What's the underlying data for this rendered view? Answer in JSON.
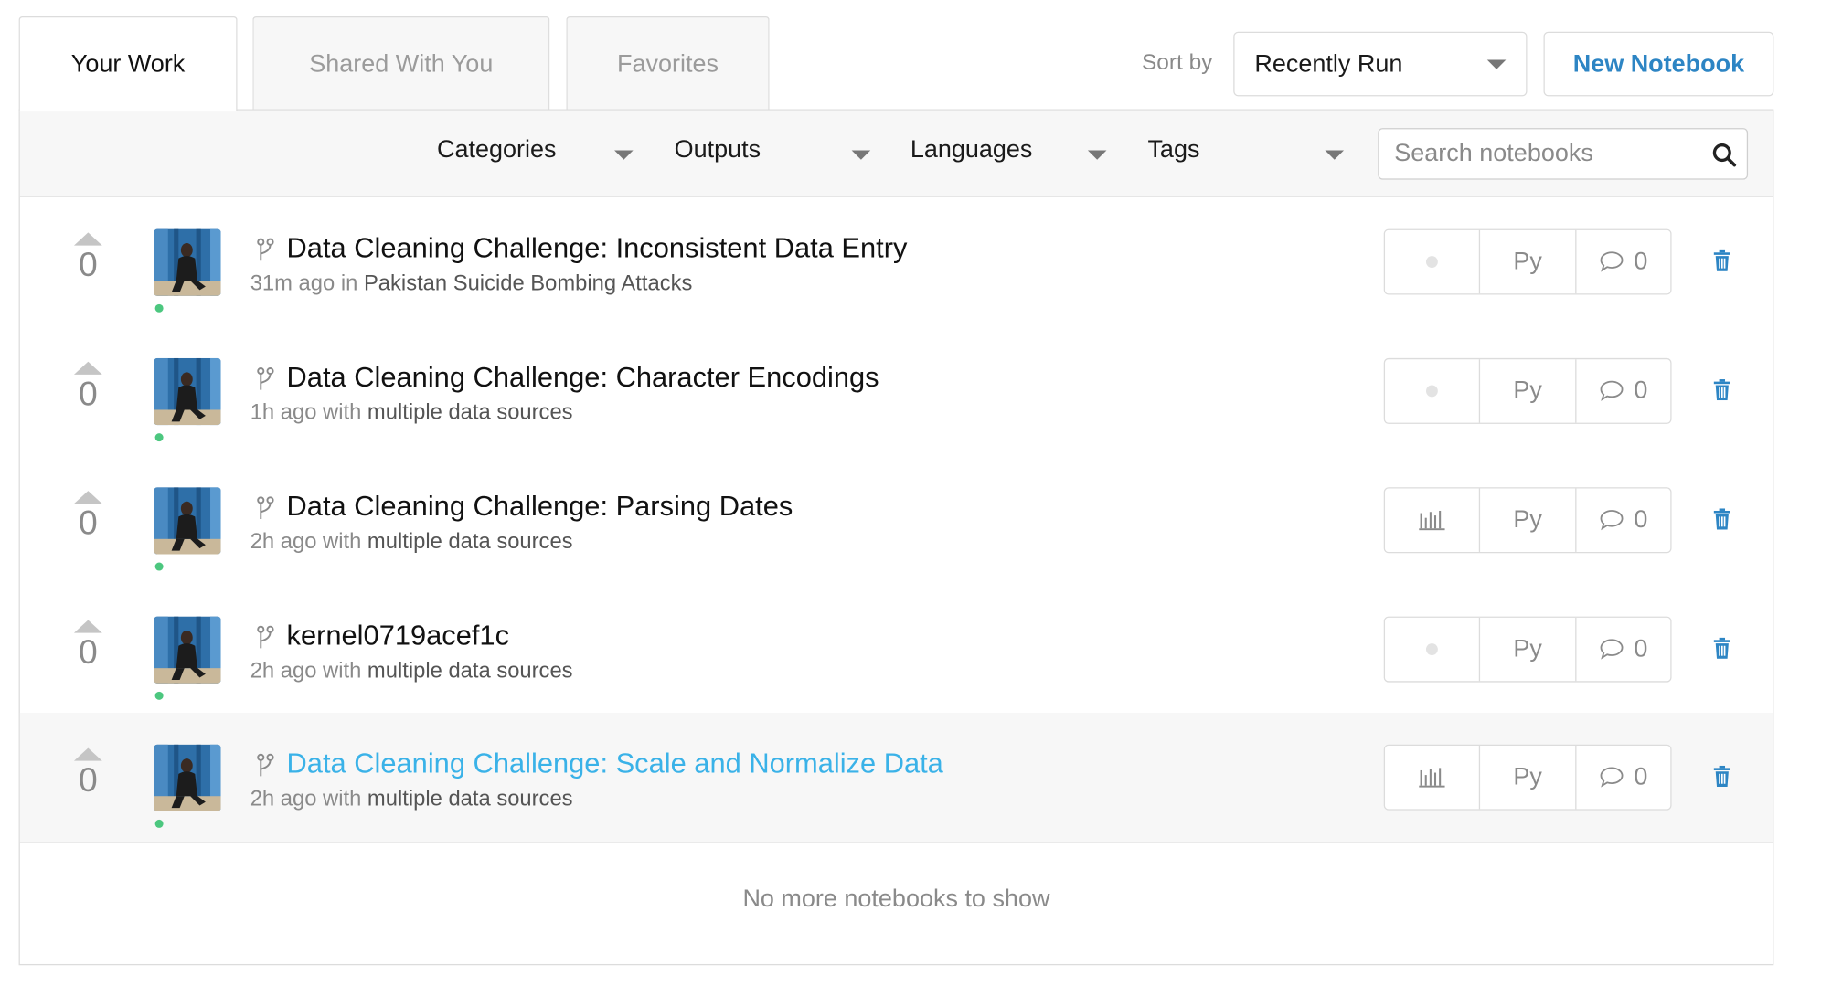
{
  "tabs": [
    {
      "label": "Your Work",
      "active": true
    },
    {
      "label": "Shared With You",
      "active": false
    },
    {
      "label": "Favorites",
      "active": false
    }
  ],
  "sort": {
    "label": "Sort by",
    "value": "Recently Run"
  },
  "new_notebook_label": "New Notebook",
  "filters": {
    "categories": "Categories",
    "outputs": "Outputs",
    "languages": "Languages",
    "tags": "Tags"
  },
  "search": {
    "placeholder": "Search notebooks"
  },
  "notebooks": [
    {
      "votes": "0",
      "title": "Data Cleaning Challenge: Inconsistent Data Entry",
      "time": "31m ago",
      "connector": "in",
      "source": "Pakistan Suicide Bombing Attacks",
      "output_icon": "status-dot-icon",
      "language": "Py",
      "comments": "0",
      "highlighted": false
    },
    {
      "votes": "0",
      "title": "Data Cleaning Challenge: Character Encodings",
      "time": "1h ago",
      "connector": "with",
      "source": "multiple data sources",
      "output_icon": "status-dot-icon",
      "language": "Py",
      "comments": "0",
      "highlighted": false
    },
    {
      "votes": "0",
      "title": "Data Cleaning Challenge: Parsing Dates",
      "time": "2h ago",
      "connector": "with",
      "source": "multiple data sources",
      "output_icon": "bar-chart-icon",
      "language": "Py",
      "comments": "0",
      "highlighted": false
    },
    {
      "votes": "0",
      "title": "kernel0719acef1c",
      "time": "2h ago",
      "connector": "with",
      "source": "multiple data sources",
      "output_icon": "status-dot-icon",
      "language": "Py",
      "comments": "0",
      "highlighted": false
    },
    {
      "votes": "0",
      "title": "Data Cleaning Challenge: Scale and Normalize Data",
      "time": "2h ago",
      "connector": "with",
      "source": "multiple data sources",
      "output_icon": "bar-chart-icon",
      "language": "Py",
      "comments": "0",
      "highlighted": true
    }
  ],
  "footer": {
    "message": "No more notebooks to show"
  },
  "colors": {
    "accent": "#2d85c4",
    "link_highlight": "#3ab2e8",
    "online": "#4cc77f",
    "muted_text": "#8a8a8a",
    "border": "#dcdcdc"
  }
}
